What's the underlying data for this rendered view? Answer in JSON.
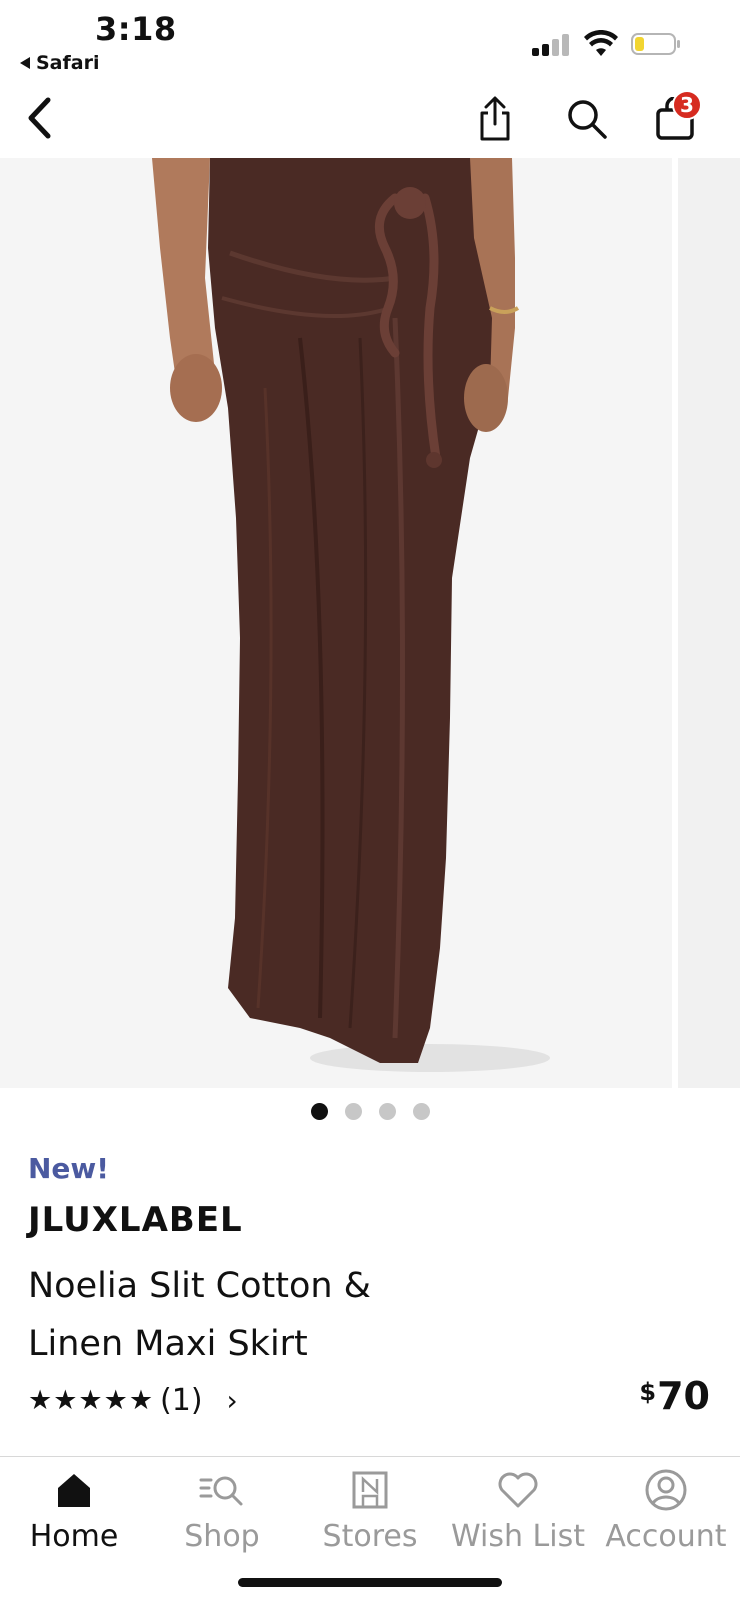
{
  "status_bar": {
    "time": "3:18",
    "back_app_label": "Safari"
  },
  "nav": {
    "back_icon": "chevron-left-icon",
    "share_icon": "share-icon",
    "search_icon": "search-icon",
    "cart_icon": "bag-icon",
    "cart_count": "3"
  },
  "gallery": {
    "image_alt": "Brown draped maxi skirt with rope tie",
    "image_count": 4,
    "active_index": 0,
    "skirt_color": "#4a2a24"
  },
  "product": {
    "badge": "New!",
    "brand": "JLUXLABEL",
    "name": "Noelia Slit Cotton & Linen Maxi Skirt",
    "stars": "★★★★★",
    "rating": 5,
    "review_count": "(1)",
    "price_currency": "$",
    "price_amount": "70"
  },
  "tabs": [
    {
      "label": "Home",
      "icon": "home-icon",
      "active": true
    },
    {
      "label": "Shop",
      "icon": "shop-search-icon",
      "active": false
    },
    {
      "label": "Stores",
      "icon": "store-icon",
      "active": false
    },
    {
      "label": "Wish List",
      "icon": "heart-icon",
      "active": false
    },
    {
      "label": "Account",
      "icon": "account-icon",
      "active": false
    }
  ],
  "colors": {
    "new_label": "#4b5aa0",
    "badge": "#d62b20",
    "inactive_tab": "#9a9a9a"
  }
}
